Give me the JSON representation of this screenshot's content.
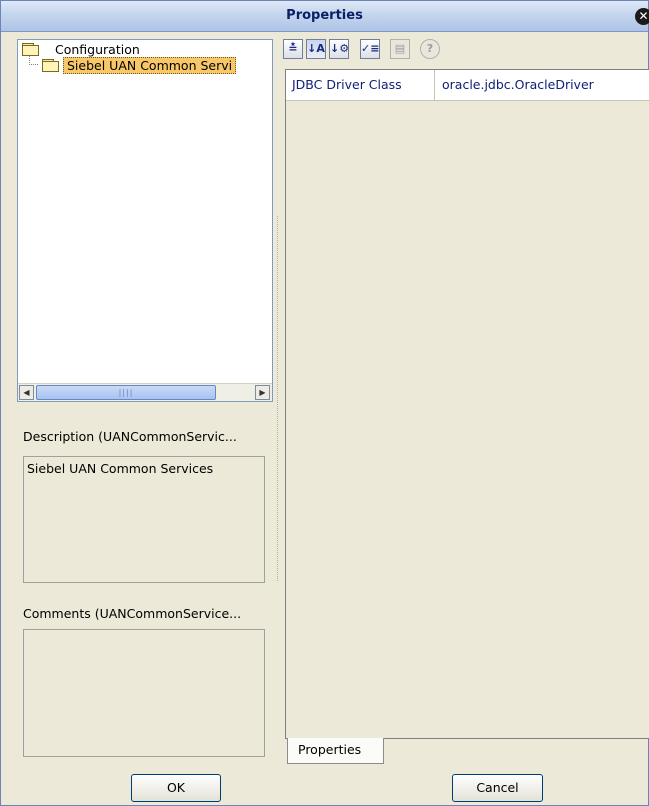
{
  "window": {
    "title": "Properties",
    "close_glyph": "✕"
  },
  "tree": {
    "root_label": "Configuration",
    "child_label": "Siebel UAN Common Servi"
  },
  "description": {
    "label": "Description (UANCommonServic...",
    "text": "Siebel UAN Common Services"
  },
  "comments": {
    "label": "Comments (UANCommonService...",
    "text": ""
  },
  "toolbar": {
    "buttons": [
      {
        "icon": "collapse-icon",
        "glyph": "≛"
      },
      {
        "icon": "sort-alphabetical-icon",
        "glyph": "↓A"
      },
      {
        "icon": "sort-category-icon",
        "glyph": "↓⚙"
      },
      {
        "icon": "checklist-icon",
        "glyph": "✓≡"
      },
      {
        "icon": "properties-view-icon",
        "glyph": "▤"
      },
      {
        "icon": "help-icon",
        "glyph": "?"
      }
    ]
  },
  "properties": {
    "rows": [
      {
        "name": "JDBC Driver Class",
        "value": "oracle.jdbc.OracleDriver"
      }
    ]
  },
  "tabs": {
    "active": "Properties"
  },
  "buttons": {
    "ok": "OK",
    "cancel": "Cancel"
  }
}
